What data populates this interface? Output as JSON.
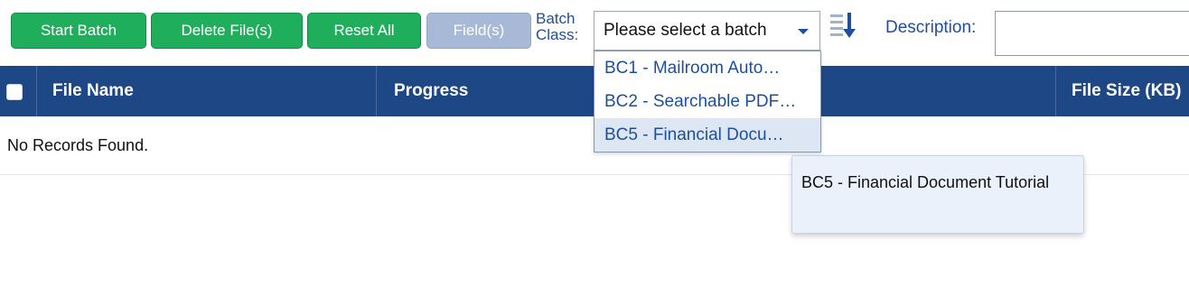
{
  "toolbar": {
    "start_batch": "Start Batch",
    "delete_files": "Delete File(s)",
    "reset_all": "Reset All",
    "fields": "Field(s)",
    "batch_class_label": "Batch Class:",
    "batch_select_value": "Please select a batch",
    "description_label": "Description:",
    "description_value": ""
  },
  "table": {
    "columns": [
      "File Name",
      "Progress",
      "File Size (KB)"
    ],
    "empty_message": "No Records Found."
  },
  "dropdown": {
    "options": [
      "BC1 - Mailroom Auto…",
      "BC2 - Searchable PDF…",
      "BC5 - Financial Docu…"
    ],
    "hovered_index": 2
  },
  "tooltip": {
    "text": "BC5 - Financial Document Tutorial"
  },
  "colors": {
    "button_green": "#1fae5c",
    "button_disabled": "#a7b9d6",
    "header_blue": "#1e4785",
    "label_blue": "#1e4f9c"
  }
}
